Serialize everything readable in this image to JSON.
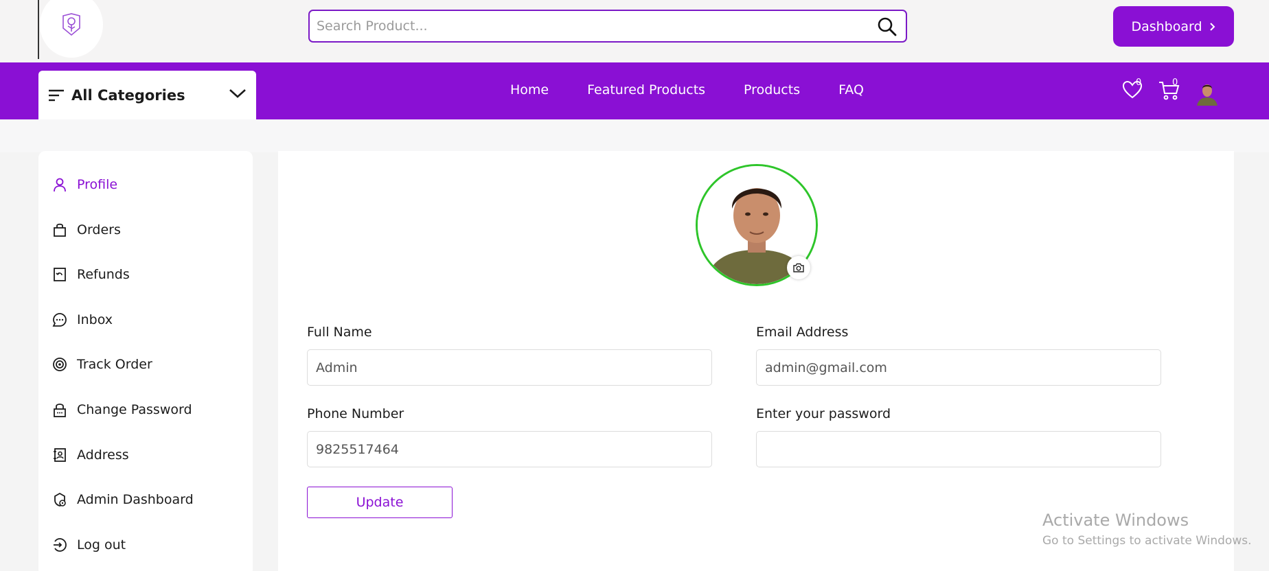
{
  "search": {
    "placeholder": "Search Product..."
  },
  "header": {
    "dashboard_label": "Dashboard"
  },
  "categories": {
    "label": "All Categories"
  },
  "nav": {
    "links": [
      "Home",
      "Featured Products",
      "Products",
      "FAQ"
    ]
  },
  "badges": {
    "wishlist_count": "0",
    "cart_count": "0"
  },
  "sidebar": {
    "items": [
      {
        "label": "Profile",
        "icon": "user-icon",
        "active": true
      },
      {
        "label": "Orders",
        "icon": "bag-icon"
      },
      {
        "label": "Refunds",
        "icon": "refund-icon"
      },
      {
        "label": "Inbox",
        "icon": "chat-icon"
      },
      {
        "label": "Track Order",
        "icon": "target-icon"
      },
      {
        "label": "Change Password",
        "icon": "lock-icon"
      },
      {
        "label": "Address",
        "icon": "address-book-icon"
      },
      {
        "label": "Admin Dashboard",
        "icon": "admin-icon"
      },
      {
        "label": "Log out",
        "icon": "logout-icon"
      }
    ]
  },
  "form": {
    "full_name": {
      "label": "Full Name",
      "value": "Admin"
    },
    "email": {
      "label": "Email Address",
      "value": "admin@gmail.com"
    },
    "phone": {
      "label": "Phone Number",
      "value": "9825517464"
    },
    "password": {
      "label": "Enter your password",
      "value": ""
    },
    "update_label": "Update"
  },
  "watermark": {
    "title": "Activate Windows",
    "subtitle": "Go to Settings to activate Windows."
  },
  "colors": {
    "brand": "#8a10d4",
    "avatar_ring": "#2ec52a"
  }
}
